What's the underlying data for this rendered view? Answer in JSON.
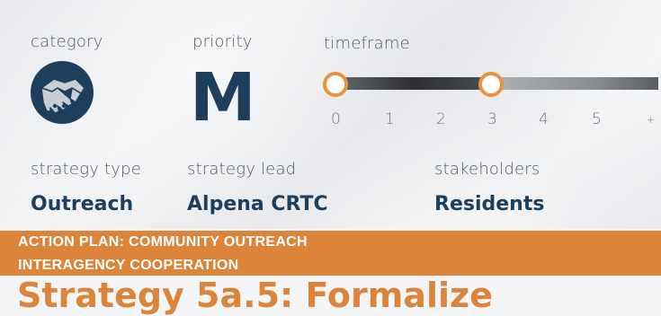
{
  "header_labels": {
    "category": "category",
    "priority": "priority",
    "timeframe": "timeframe"
  },
  "category": {
    "icon": "handshake-icon"
  },
  "priority": {
    "value": "M"
  },
  "timeframe": {
    "ticks": [
      "0",
      "1",
      "2",
      "3",
      "4",
      "5",
      "+"
    ],
    "range_start": 0,
    "range_end": 3,
    "accent_color": "#e8933e"
  },
  "details": {
    "strategy_type_label": "strategy type",
    "strategy_type_value": "Outreach",
    "strategy_lead_label": "strategy lead",
    "strategy_lead_value": "Alpena CRTC",
    "stakeholders_label": "stakeholders",
    "stakeholders_value": "Residents"
  },
  "banner": {
    "line1": "ACTION PLAN: COMMUNITY OUTREACH",
    "line2": "INTERAGENCY COOPERATION",
    "color": "#dc843a"
  },
  "strategy_title": "Strategy 5a.5: Formalize"
}
